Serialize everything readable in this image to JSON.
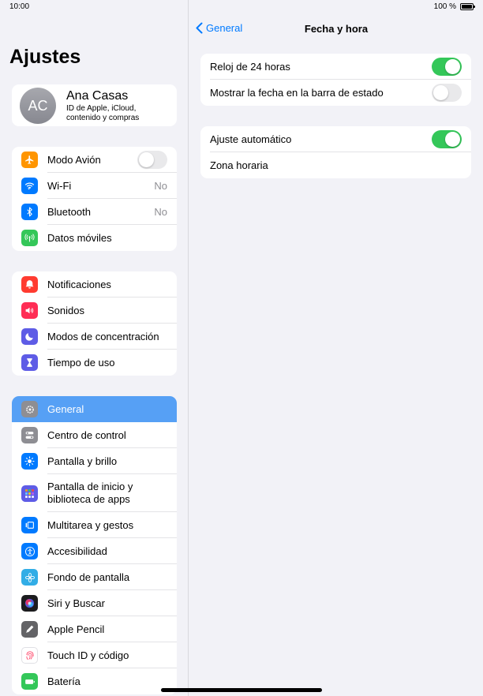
{
  "status": {
    "time": "10:00",
    "battery": "100 %"
  },
  "sidebar": {
    "title": "Ajustes",
    "profile": {
      "initials": "AC",
      "name": "Ana Casas",
      "subtitle": "ID de Apple, iCloud, contenido y compras"
    },
    "group1": [
      {
        "label": "Modo Avión",
        "icon": "airplane-icon",
        "color": "#ff9500",
        "toggle": false
      },
      {
        "label": "Wi-Fi",
        "icon": "wifi-icon",
        "color": "#007aff",
        "value": "No"
      },
      {
        "label": "Bluetooth",
        "icon": "bluetooth-icon",
        "color": "#007aff",
        "value": "No"
      },
      {
        "label": "Datos móviles",
        "icon": "antenna-icon",
        "color": "#34c759"
      }
    ],
    "group2": [
      {
        "label": "Notificaciones",
        "icon": "bell-icon",
        "color": "#ff3b30"
      },
      {
        "label": "Sonidos",
        "icon": "speaker-icon",
        "color": "#ff2d55"
      },
      {
        "label": "Modos de concentración",
        "icon": "moon-icon",
        "color": "#5e5ce6"
      },
      {
        "label": "Tiempo de uso",
        "icon": "hourglass-icon",
        "color": "#5e5ce6"
      }
    ],
    "group3": [
      {
        "label": "General",
        "icon": "gear-icon",
        "color": "#8e8e93"
      },
      {
        "label": "Centro de control",
        "icon": "switches-icon",
        "color": "#8e8e93"
      },
      {
        "label": "Pantalla y brillo",
        "icon": "sun-icon",
        "color": "#007aff"
      },
      {
        "label": "Pantalla de inicio y biblioteca de apps",
        "icon": "grid-icon",
        "color": "#5e5ce6"
      },
      {
        "label": "Multitarea y gestos",
        "icon": "multitask-icon",
        "color": "#007aff"
      },
      {
        "label": "Accesibilidad",
        "icon": "accessibility-icon",
        "color": "#007aff"
      },
      {
        "label": "Fondo de pantalla",
        "icon": "flower-icon",
        "color": "#32ade6"
      },
      {
        "label": "Siri y Buscar",
        "icon": "siri-icon",
        "color": "#1c1c1e"
      },
      {
        "label": "Apple Pencil",
        "icon": "pencil-icon",
        "color": "#636366"
      },
      {
        "label": "Touch ID y código",
        "icon": "fingerprint-icon",
        "color": "#ffffff"
      },
      {
        "label": "Batería",
        "icon": "battery-icon",
        "color": "#34c759"
      }
    ]
  },
  "detail": {
    "back_label": "General",
    "title": "Fecha y hora",
    "group1": [
      {
        "label": "Reloj de 24 horas",
        "toggle": true
      },
      {
        "label": "Mostrar la fecha en la barra de estado",
        "toggle": false
      }
    ],
    "group2": [
      {
        "label": "Ajuste automático",
        "toggle": true
      },
      {
        "label": "Zona horaria"
      }
    ]
  }
}
